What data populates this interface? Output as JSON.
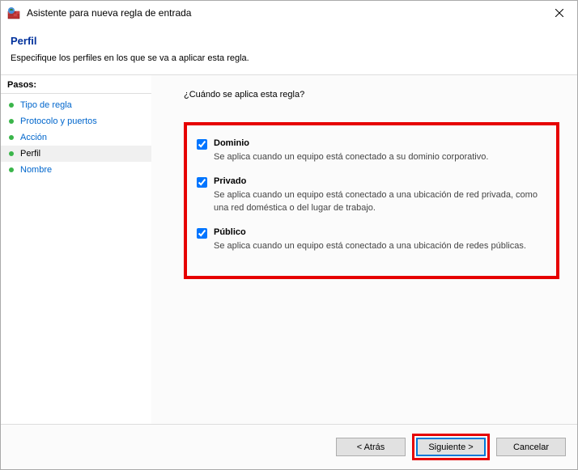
{
  "titlebar": {
    "title": "Asistente para nueva regla de entrada"
  },
  "header": {
    "title": "Perfil",
    "subtitle": "Especifique los perfiles en los que se va a aplicar esta regla."
  },
  "sidebar": {
    "title": "Pasos:",
    "items": [
      {
        "label": "Tipo de regla",
        "state": "done"
      },
      {
        "label": "Protocolo y puertos",
        "state": "done"
      },
      {
        "label": "Acción",
        "state": "done"
      },
      {
        "label": "Perfil",
        "state": "current"
      },
      {
        "label": "Nombre",
        "state": "pending"
      }
    ]
  },
  "content": {
    "question": "¿Cuándo se aplica esta regla?",
    "options": [
      {
        "title": "Dominio",
        "desc": "Se aplica cuando un equipo está conectado a su dominio corporativo.",
        "checked": true
      },
      {
        "title": "Privado",
        "desc": "Se aplica cuando un equipo está conectado a una ubicación de red privada, como una red doméstica o del lugar de trabajo.",
        "checked": true
      },
      {
        "title": "Público",
        "desc": "Se aplica cuando un equipo está conectado a una ubicación de redes públicas.",
        "checked": true
      }
    ]
  },
  "footer": {
    "back": "< Atrás",
    "next": "Siguiente >",
    "cancel": "Cancelar"
  }
}
